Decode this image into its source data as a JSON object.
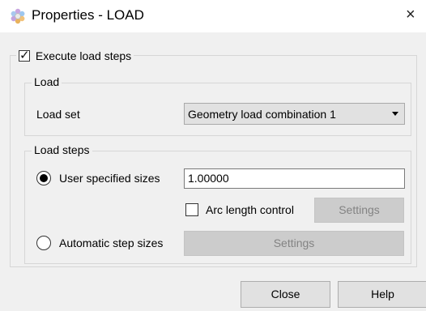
{
  "window": {
    "title": "Properties - LOAD",
    "close_symbol": "×",
    "icon": "gear-flower-icon"
  },
  "execute": {
    "label": "Execute load steps",
    "checked": true
  },
  "load_group": {
    "legend": "Load",
    "load_set_label": "Load set",
    "load_set_value": "Geometry load combination 1"
  },
  "load_steps_group": {
    "legend": "Load steps",
    "user_specified_label": "User specified sizes",
    "user_specified_selected": true,
    "step_size_value": "1.00000",
    "arc_length_label": "Arc length control",
    "arc_length_checked": false,
    "arc_settings_label": "Settings",
    "automatic_label": "Automatic step sizes",
    "automatic_selected": false,
    "automatic_settings_label": "Settings"
  },
  "footer": {
    "close_label": "Close",
    "help_label": "Help"
  }
}
